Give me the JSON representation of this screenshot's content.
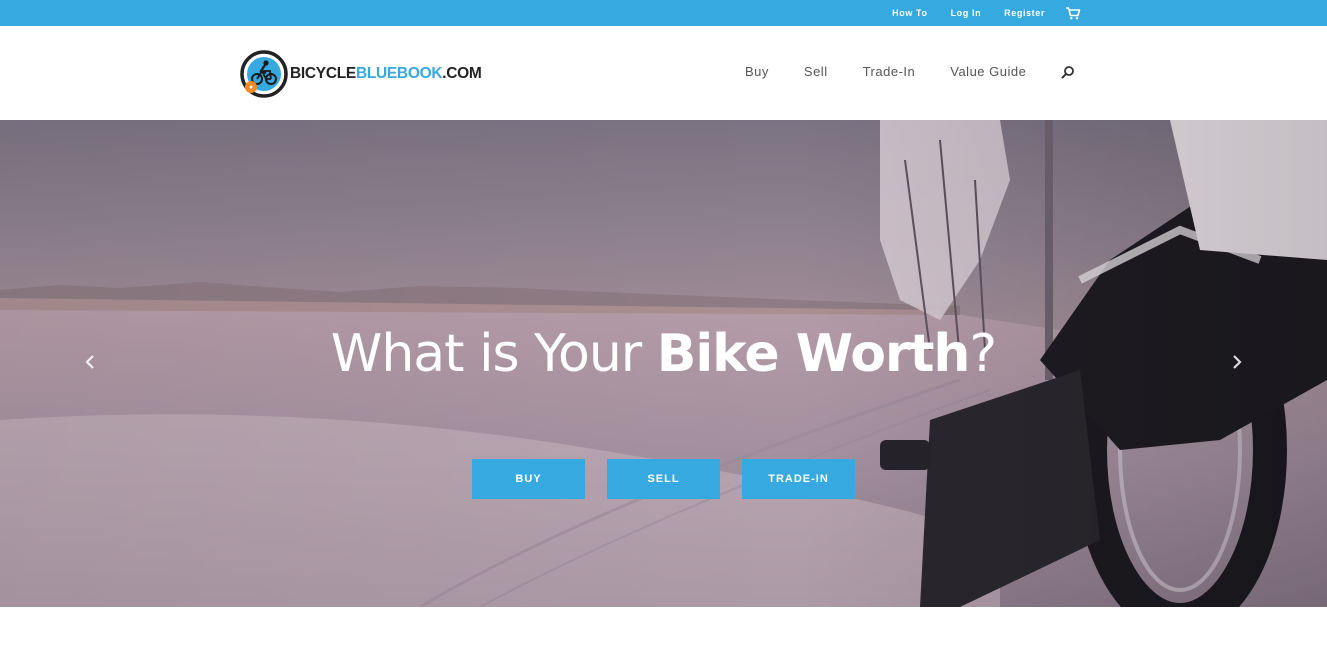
{
  "topbar": {
    "links": [
      "How To",
      "Log In",
      "Register"
    ],
    "cart_icon": "shopping-cart-icon",
    "color": "#36a9e1"
  },
  "header": {
    "logo": {
      "text_dark_1": "BICYCLE",
      "text_blue": "BLUEBOOK",
      "text_dark_2": ".COM",
      "icon": "cyclist-logo-icon"
    },
    "nav": [
      "Buy",
      "Sell",
      "Trade-In",
      "Value Guide"
    ],
    "search_icon": "search-icon"
  },
  "hero": {
    "title_regular": "What is Your ",
    "title_bold": "Bike Worth",
    "title_end": "?",
    "buttons": [
      "BUY",
      "SELL",
      "TRADE-IN"
    ],
    "prev_icon": "chevron-left-icon",
    "next_icon": "chevron-right-icon",
    "accent": "#36a9e1"
  }
}
